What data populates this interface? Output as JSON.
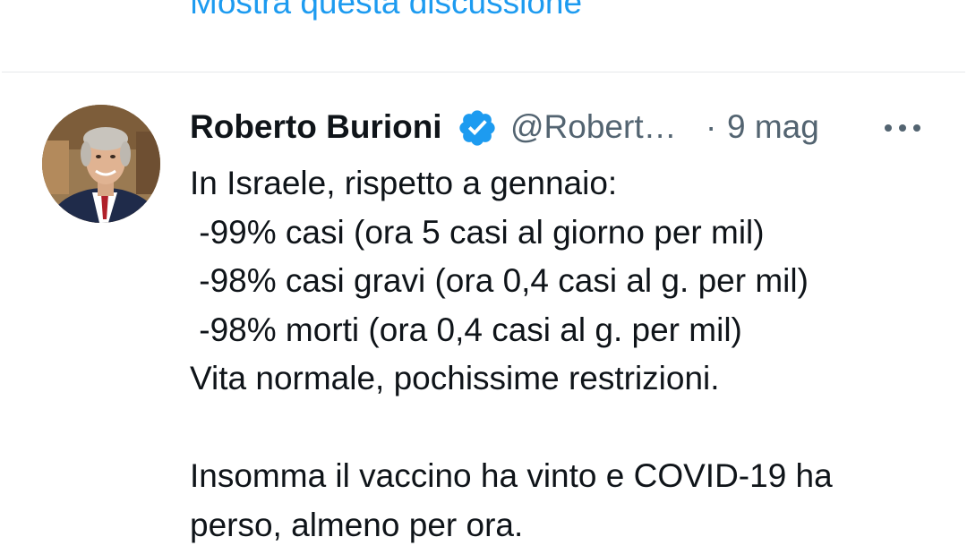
{
  "thread": {
    "show_thread_label": "Mostra questa discussione"
  },
  "tweet": {
    "author_name": "Roberto Burioni",
    "handle": "@Robert…",
    "separator": "·",
    "time": "9 mag",
    "verified_icon": "verified-badge-icon",
    "more_icon": "more-options-icon",
    "text_lines": [
      "In Israele, rispetto a gennaio:",
      " -99% casi (ora 5 casi al giorno per mil)",
      " -98% casi gravi (ora 0,4 casi al g. per mil)",
      " -98% morti (ora 0,4 casi al g. per mil)",
      "Vita normale, pochissime restrizioni.",
      "",
      "Insomma il vaccino ha vinto e COVID-19 ha",
      "perso, almeno per ora."
    ]
  },
  "colors": {
    "link": "#1d9bf0",
    "secondary_text": "#536471",
    "primary_text": "#0f1419",
    "divider": "#e6e9eb"
  }
}
